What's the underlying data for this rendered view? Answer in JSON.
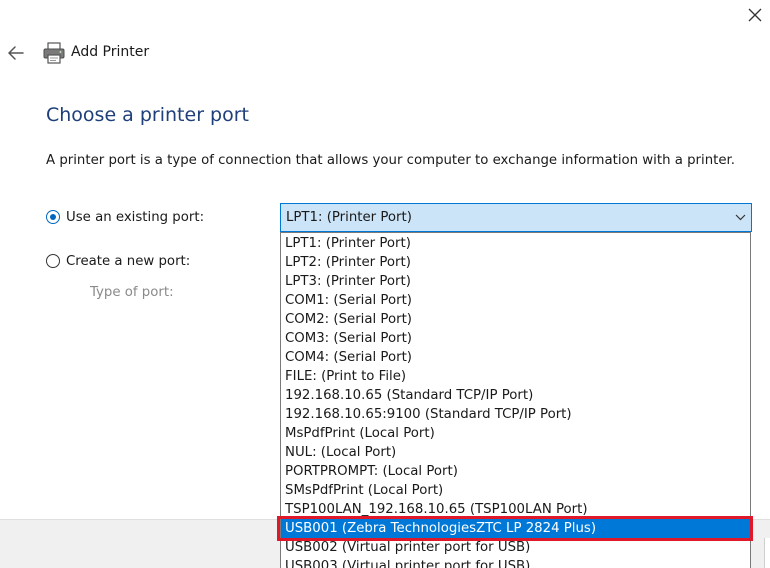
{
  "header": {
    "title": "Add Printer"
  },
  "page": {
    "title": "Choose a printer port",
    "description": "A printer port is a type of connection that allows your computer to exchange information with a printer."
  },
  "options": {
    "existing_port_label": "Use an existing port:",
    "new_port_label": "Create a new port:",
    "type_of_port_label": "Type of port:",
    "selected_mode": "existing"
  },
  "combo": {
    "value": "LPT1: (Printer Port)"
  },
  "dropdown": {
    "items": [
      "LPT1: (Printer Port)",
      "LPT2: (Printer Port)",
      "LPT3: (Printer Port)",
      "COM1: (Serial Port)",
      "COM2: (Serial Port)",
      "COM3: (Serial Port)",
      "COM4: (Serial Port)",
      "FILE: (Print to File)",
      "192.168.10.65 (Standard TCP/IP Port)",
      "192.168.10.65:9100 (Standard TCP/IP Port)",
      "MsPdfPrint (Local Port)",
      "NUL: (Local Port)",
      "PORTPROMPT: (Local Port)",
      "SMsPdfPrint (Local Port)",
      "TSP100LAN_192.168.10.65 (TSP100LAN Port)",
      "USB001 (Zebra TechnologiesZTC LP 2824 Plus)",
      "USB002 (Virtual printer port for USB)",
      "USB003 (Virtual printer port for USB)"
    ],
    "highlighted_item": "USB001 (Zebra TechnologiesZTC LP 2824 Plus)"
  },
  "colors": {
    "title": "#1e3f7a",
    "accent": "#0078d7",
    "highlight_frame": "#e0192a"
  },
  "icons": {
    "close": "close-icon",
    "back": "back-arrow-icon",
    "printer": "printer-icon",
    "dropdown": "chevron-down-icon"
  }
}
